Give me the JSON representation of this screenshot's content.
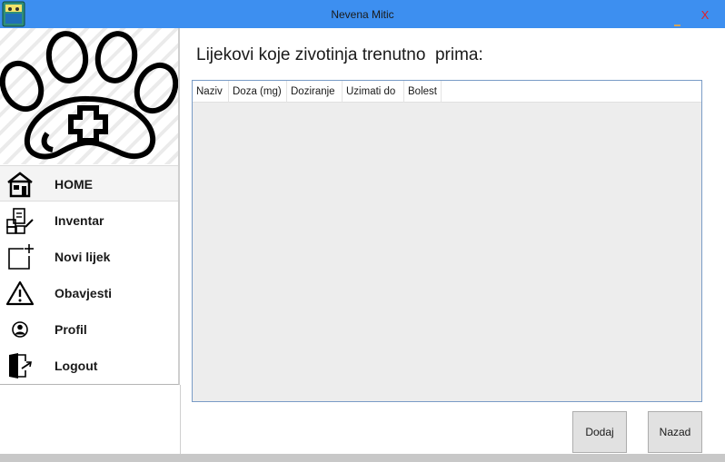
{
  "window": {
    "title": "Nevena Mitic",
    "close_label": "X"
  },
  "sidebar": {
    "items": [
      {
        "label": "HOME",
        "icon": "home-icon",
        "active": true
      },
      {
        "label": "Inventar",
        "icon": "inventory-icon",
        "active": false
      },
      {
        "label": "Novi lijek",
        "icon": "new-item-icon",
        "active": false
      },
      {
        "label": "Obavjesti",
        "icon": "warning-icon",
        "active": false
      },
      {
        "label": "Profil",
        "icon": "profile-icon",
        "active": false
      },
      {
        "label": "Logout",
        "icon": "logout-icon",
        "active": false
      }
    ]
  },
  "main": {
    "title": "Lijekovi koje zivotinja trenutno  prima:",
    "table": {
      "columns": [
        "Naziv",
        "Doza (mg)",
        "Doziranje",
        "Uzimati do",
        "Bolest"
      ],
      "rows": []
    },
    "buttons": {
      "add_label": "Dodaj",
      "back_label": "Nazad"
    }
  },
  "colors": {
    "titlebar": "#3d8ff0",
    "close": "#e0202a",
    "grid_border": "#7a9cc6",
    "grid_background": "#ededed"
  }
}
